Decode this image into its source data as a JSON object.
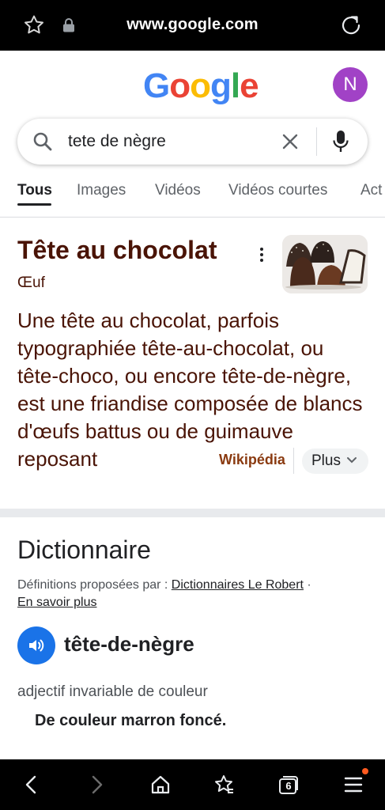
{
  "browser": {
    "url": "www.google.com",
    "tab_count": "6"
  },
  "google": {
    "logo_letters": [
      "G",
      "o",
      "o",
      "g",
      "l",
      "e"
    ],
    "logo_colors": [
      "#4285F4",
      "#EA4335",
      "#FBBC05",
      "#4285F4",
      "#34A853",
      "#EA4335"
    ],
    "avatar_initial": "N"
  },
  "search": {
    "query": "tete de nègre"
  },
  "tabs": [
    {
      "label": "Tous",
      "active": true
    },
    {
      "label": "Images"
    },
    {
      "label": "Vidéos"
    },
    {
      "label": "Vidéos courtes"
    },
    {
      "label": "Act"
    }
  ],
  "knowledge_panel": {
    "title": "Tête au chocolat",
    "subtitle": "Œuf",
    "description": "Une tête au chocolat, parfois typographiée tête-au-chocolat, ou tête-choco, ou encore tête-de-nègre, est une friandise composée de blancs d'œufs battus ou de guimauve reposant",
    "source": "Wikipédia",
    "more_label": "Plus"
  },
  "dictionary": {
    "title": "Dictionnaire",
    "provided_by_prefix": "Définitions proposées par : ",
    "provider": "Dictionnaires Le Robert",
    "provider_sep": " ·",
    "learn_more": "En savoir plus",
    "headword": "tête-de-nègre",
    "part_of_speech": "adjectif invariable de couleur",
    "definition": "De couleur marron foncé."
  },
  "colors": {
    "panel_text": "#4a1406",
    "accent_blue": "#1a73e8"
  }
}
